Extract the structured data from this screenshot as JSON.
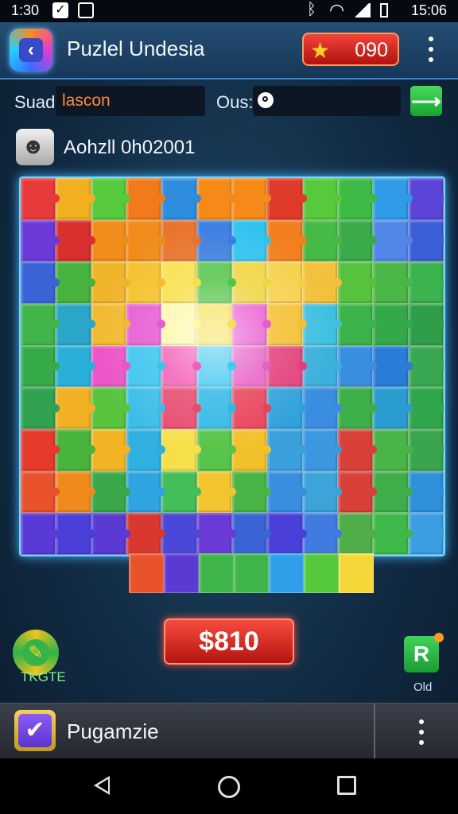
{
  "status_bar": {
    "time": "1:30",
    "clock": "15:06"
  },
  "header": {
    "title": "Puzlel Undesia",
    "score": "090"
  },
  "search": {
    "label": "Suad",
    "value": "lascon",
    "ops_label": "Ous:"
  },
  "player": {
    "name": "Aohzll 0h02001"
  },
  "board": {
    "colors": [
      [
        "#e83a3a",
        "#f2b020",
        "#56c93c",
        "#f17a1a",
        "#2f8de0",
        "#f58a18",
        "#f58a18",
        "#e03a2a",
        "#56c93c",
        "#3dbb46",
        "#2e9ae8",
        "#5b45d8"
      ],
      [
        "#6d38d8",
        "#d8302e",
        "#f08c1a",
        "#f08c1a",
        "#e8732a",
        "#3a7ee0",
        "#2fc3ee",
        "#f27f1e",
        "#47b945",
        "#3aaa4a",
        "#4f86e8",
        "#3c5fd8"
      ],
      [
        "#3a63d6",
        "#48b23e",
        "#f0b42a",
        "#f6c02a",
        "#f8e04a",
        "#55c54a",
        "#f0d440",
        "#f6d04a",
        "#f2c03a",
        "#56c23e",
        "#49b645",
        "#3bb34e"
      ],
      [
        "#41b549",
        "#2aa6c8",
        "#f2ba30",
        "#e65bd4",
        "#fef8a8",
        "#f7e050",
        "#e85ad0",
        "#f4c030",
        "#3ec0e0",
        "#3cb24a",
        "#35a94a",
        "#2f9e4a"
      ],
      [
        "#37aa48",
        "#2ab0d8",
        "#ec54c8",
        "#3cc4ee",
        "#f35fb8",
        "#44c8f0",
        "#e660c6",
        "#e23f7a",
        "#3ab0dc",
        "#3a8ee0",
        "#2a7cd6",
        "#3aa852"
      ],
      [
        "#32a250",
        "#f2b024",
        "#58c43e",
        "#3bbde8",
        "#e84a70",
        "#33b8e6",
        "#e8425a",
        "#2fa0dc",
        "#3a8de0",
        "#3cae4a",
        "#2a9cd0",
        "#2fa54c"
      ],
      [
        "#e63a2c",
        "#49b43c",
        "#f2b424",
        "#2fb0e0",
        "#f6e04a",
        "#56c448",
        "#f2c02a",
        "#3aa0dc",
        "#3c96e0",
        "#d8403a",
        "#49b448",
        "#3aa54c"
      ],
      [
        "#e8522c",
        "#f08a1c",
        "#3aa84a",
        "#2fa4e0",
        "#44be58",
        "#f2c42e",
        "#49b446",
        "#3a8ee0",
        "#3ca4d8",
        "#d8403a",
        "#3fae4a",
        "#2f90dc"
      ],
      [
        "#5a3ad6",
        "#4a3fd8",
        "#5b3ad4",
        "#d8382e",
        "#4a48d6",
        "#6a3ad6",
        "#3a63d6",
        "#4a3fd8",
        "#3f7be0",
        "#4fae4a",
        "#3fb84a",
        "#3a9ee0"
      ]
    ],
    "strip_colors": [
      "#e8522c",
      "#5b3ad4",
      "#3fb448",
      "#3fb448",
      "#2fa0e8",
      "#56c83c",
      "#f4d83a"
    ]
  },
  "actions": {
    "price": "$810",
    "bonus_label": "TKGTE",
    "r_glyph": "R",
    "r_label": "Old"
  },
  "bottom_bar": {
    "title": "Pugamzie"
  }
}
